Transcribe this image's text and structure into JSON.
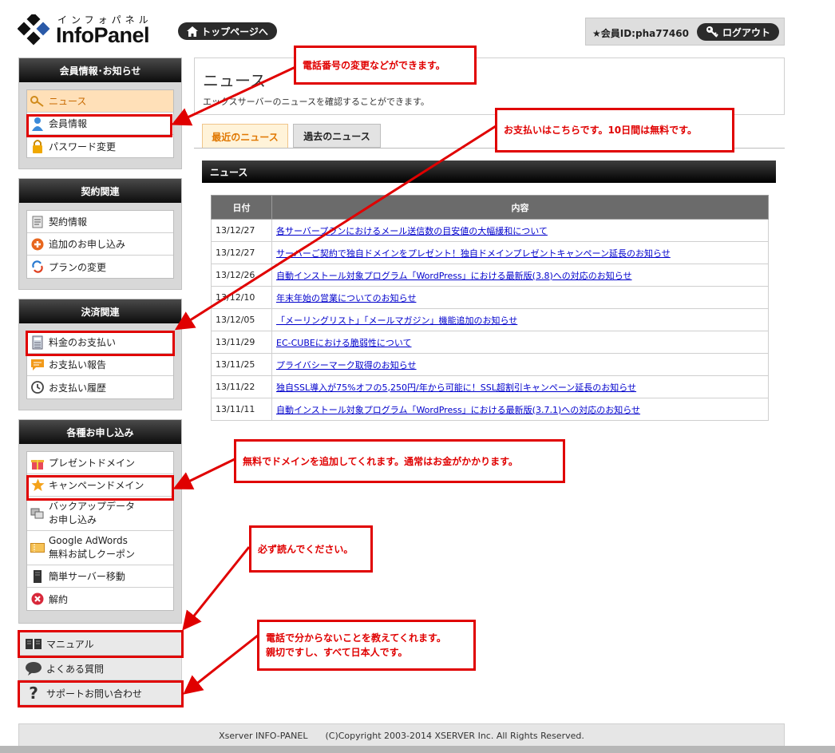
{
  "header": {
    "logo_kana": "インフォパネル",
    "logo_word": "InfoPanel",
    "top_page_label": "トップページへ",
    "member_id": "★会員ID:pha77460",
    "logout_label": "ログアウト"
  },
  "sidebar": {
    "account": {
      "title": "会員情報･お知らせ",
      "items": [
        {
          "label": "ニュース",
          "icon": "key-icon"
        },
        {
          "label": "会員情報",
          "icon": "user-icon"
        },
        {
          "label": "パスワード変更",
          "icon": "lock-icon"
        }
      ]
    },
    "contract": {
      "title": "契約関連",
      "items": [
        {
          "label": "契約情報",
          "icon": "document-icon"
        },
        {
          "label": "追加のお申し込み",
          "icon": "plus-icon"
        },
        {
          "label": "プランの変更",
          "icon": "refresh-icon"
        }
      ]
    },
    "payment": {
      "title": "決済関連",
      "items": [
        {
          "label": "料金のお支払い",
          "icon": "calculator-icon"
        },
        {
          "label": "お支払い報告",
          "icon": "message-icon"
        },
        {
          "label": "お支払い履歴",
          "icon": "clock-icon"
        }
      ]
    },
    "apply": {
      "title": "各種お申し込み",
      "items": [
        {
          "label": "プレゼントドメイン",
          "icon": "gift-icon"
        },
        {
          "label": "キャンペーンドメイン",
          "icon": "star-icon"
        },
        {
          "label1": "バックアップデータ",
          "label2": "お申し込み",
          "icon": "backup-icon"
        },
        {
          "label1": "Google AdWords",
          "label2": "無料お試しクーポン",
          "icon": "coupon-icon"
        },
        {
          "label": "簡単サーバー移動",
          "icon": "server-icon"
        },
        {
          "label": "解約",
          "icon": "cancel-icon"
        }
      ]
    },
    "links": [
      {
        "label": "マニュアル",
        "icon": "book-icon"
      },
      {
        "label": "よくある質問",
        "icon": "chat-icon"
      },
      {
        "label": "サポートお問い合わせ",
        "icon": "question-icon"
      }
    ]
  },
  "main": {
    "title": "ニュース",
    "description": "エックスサーバーのニュースを確認することができます。",
    "tabs": [
      "最近のニュース",
      "過去のニュース"
    ],
    "section_title": "ニュース",
    "table": {
      "headers": [
        "日付",
        "内容"
      ],
      "rows": [
        {
          "date": "13/12/27",
          "text": "各サーバープランにおけるメール送信数の目安値の大幅緩和について"
        },
        {
          "date": "13/12/27",
          "text": "サーバーご契約で独自ドメインをプレゼント！独自ドメインプレゼントキャンペーン延長のお知らせ"
        },
        {
          "date": "13/12/26",
          "text": "自動インストール対象プログラム「WordPress」における最新版(3.8)への対応のお知らせ"
        },
        {
          "date": "13/12/10",
          "text": "年末年始の営業についてのお知らせ"
        },
        {
          "date": "13/12/05",
          "text": "「メーリングリスト」「メールマガジン」機能追加のお知らせ"
        },
        {
          "date": "13/11/29",
          "text": "EC-CUBEにおける脆弱性について"
        },
        {
          "date": "13/11/25",
          "text": "プライバシーマーク取得のお知らせ"
        },
        {
          "date": "13/11/22",
          "text": "独自SSL導入が75%オフの5,250円/年から可能に！SSL超割引キャンペーン延長のお知らせ"
        },
        {
          "date": "13/11/11",
          "text": "自動インストール対象プログラム「WordPress」における最新版(3.7.1)への対応のお知らせ"
        }
      ]
    }
  },
  "annotations": {
    "phone": "電話番号の変更などができます。",
    "payment": "お支払いはこちらです。10日間は無料です。",
    "domain": "無料でドメインを追加してくれます。通常はお金がかかります。",
    "manual": "必ず読んでください。",
    "support_line1": "電話で分からないことを教えてくれます。",
    "support_line2": "親切ですし、すべて日本人です。"
  },
  "footer": "Xserver INFO-PANEL　　(C)Copyright 2003-2014 XSERVER Inc. All Rights Reserved."
}
